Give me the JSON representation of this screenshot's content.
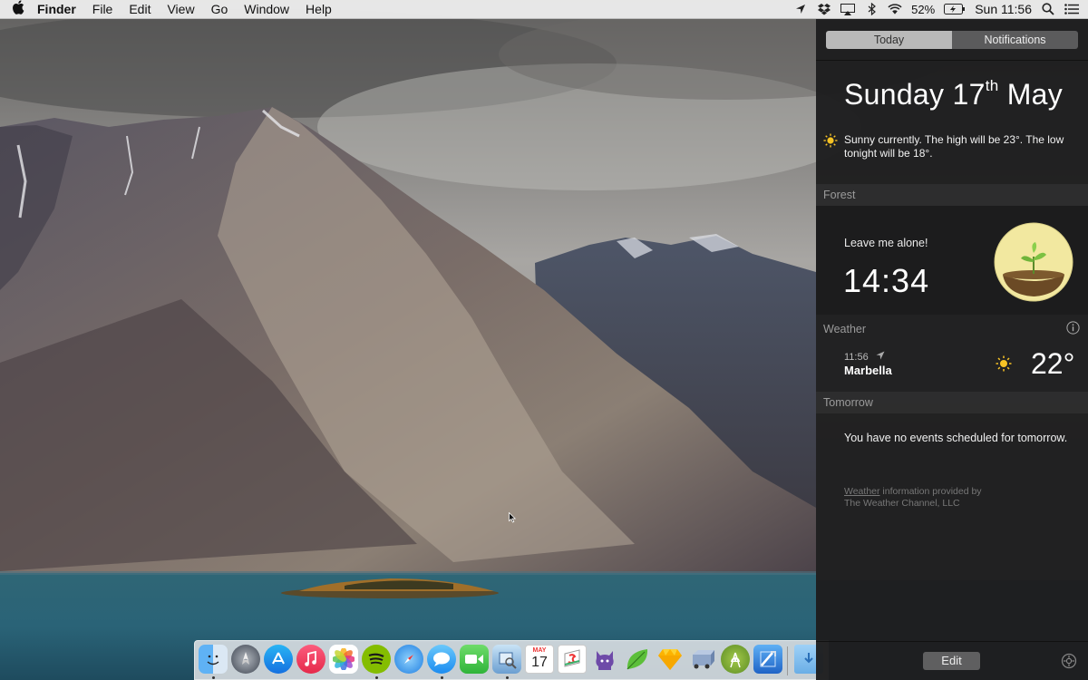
{
  "menubar": {
    "apple_icon": "apple-logo-icon",
    "items": [
      "Finder",
      "File",
      "Edit",
      "View",
      "Go",
      "Window",
      "Help"
    ],
    "battery": "52%",
    "clock": "Sun 11:56",
    "status_icons": [
      "location-icon",
      "dropbox-icon",
      "airplay-icon",
      "bluetooth-icon",
      "wifi-icon",
      "battery-charging-icon",
      "spotlight-icon",
      "notification-center-icon"
    ]
  },
  "notification_center": {
    "tabs": {
      "today": "Today",
      "notifications": "Notifications"
    },
    "date": {
      "day": "Sunday 17",
      "suffix": "th",
      "month": " May"
    },
    "summary": "Sunny currently. The high will be 23°. The low tonight will be 18°.",
    "forest": {
      "title": "Forest",
      "message": "Leave me alone!",
      "timer": "14:34"
    },
    "weather": {
      "title": "Weather",
      "time": "11:56",
      "city": "Marbella",
      "temp": "22°"
    },
    "tomorrow": {
      "title": "Tomorrow",
      "message": "You have no events scheduled for tomorrow."
    },
    "credit": {
      "link": "Weather",
      "line1_rest": " information provided by",
      "line2": "The Weather Channel, LLC"
    },
    "edit_label": "Edit"
  },
  "dock": {
    "apps": [
      "finder",
      "launchpad",
      "app-store",
      "itunes",
      "photos",
      "spotify",
      "safari",
      "messages",
      "facetime",
      "preview",
      "calendar",
      "sketch-s",
      "github",
      "leaf",
      "sketch",
      "transmit",
      "android-studio",
      "xcode",
      "downloads-folder"
    ],
    "calendar_month": "MAY",
    "calendar_day": "17"
  },
  "colors": {
    "accent_sun": "#f7c325",
    "nc_background": "#1e1e1f",
    "forest_circle": "#f2e8a0",
    "spotify": "#84bd00"
  }
}
